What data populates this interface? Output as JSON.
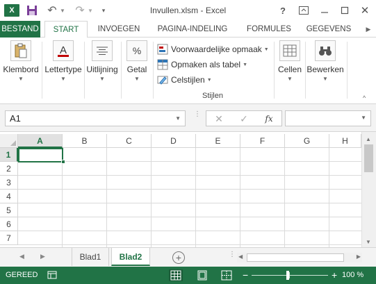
{
  "titlebar": {
    "title": "Invullen.xlsm - Excel",
    "app_icon": "X",
    "icons": [
      "excel-logo-icon",
      "save-icon",
      "undo-icon",
      "redo-icon",
      "customize-qat-icon",
      "help-icon",
      "ribbon-display-icon",
      "minimize-icon",
      "maximize-icon",
      "close-icon"
    ],
    "help": "?"
  },
  "tabs": {
    "file": "BESTAND",
    "items": [
      "START",
      "INVOEGEN",
      "PAGINA-INDELING",
      "FORMULES",
      "GEGEVENS"
    ],
    "active": "START"
  },
  "ribbon": {
    "groups": {
      "klembord": "Klembord",
      "lettertype": "Lettertype",
      "uitlijning": "Uitlijning",
      "getal": "Getal",
      "cellen": "Cellen",
      "bewerken": "Bewerken"
    },
    "getal_symbol": "%",
    "stijlen": {
      "label": "Stijlen",
      "items": [
        "Voorwaardelijke opmaak",
        "Opmaken als tabel",
        "Celstijlen"
      ]
    }
  },
  "formula_bar": {
    "name_box": "A1",
    "fx": "fx",
    "formula": ""
  },
  "grid": {
    "columns": [
      "A",
      "B",
      "C",
      "D",
      "E",
      "F",
      "G",
      "H"
    ],
    "rows": [
      "1",
      "2",
      "3",
      "4",
      "5",
      "6",
      "7"
    ],
    "selected_cell": "A1"
  },
  "sheets": {
    "tabs": [
      "Blad1",
      "Blad2"
    ],
    "active": "Blad2",
    "add": "+"
  },
  "statusbar": {
    "status": "GEREED",
    "zoom": "100 %"
  },
  "colors": {
    "accent": "#217346",
    "statusbar": "#217346",
    "gridline": "#dadada"
  }
}
